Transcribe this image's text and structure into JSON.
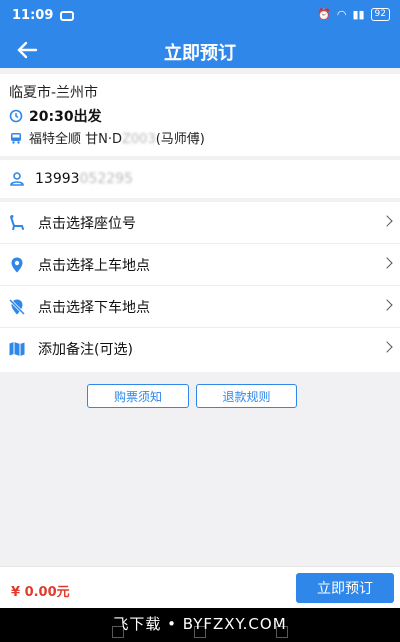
{
  "status": {
    "time": "11:09",
    "battery": "92"
  },
  "header": {
    "title": "立即预订"
  },
  "trip": {
    "route": "临夏市-兰州市",
    "depart": "20:30出发",
    "car_prefix": "福特全顺 甘N·D",
    "car_masked": "Z003",
    "car_suffix": "(马师傅)"
  },
  "passenger": {
    "phone_prefix": "13993",
    "phone_masked": "052295"
  },
  "options": [
    {
      "label": "点击选择座位号",
      "icon": "seat-icon"
    },
    {
      "label": "点击选择上车地点",
      "icon": "location-pin-icon"
    },
    {
      "label": "点击选择下车地点",
      "icon": "location-off-icon"
    },
    {
      "label": "添加备注(可选)",
      "icon": "map-icon"
    }
  ],
  "links": {
    "ticket_notice": "购票须知",
    "refund_rules": "退款规则"
  },
  "footer": {
    "price": "¥ 0.00元",
    "book_label": "立即预订"
  },
  "watermark": "飞下载 • BYFZXY.COM",
  "colors": {
    "primary": "#2f87e9",
    "price": "#e23b2b"
  }
}
